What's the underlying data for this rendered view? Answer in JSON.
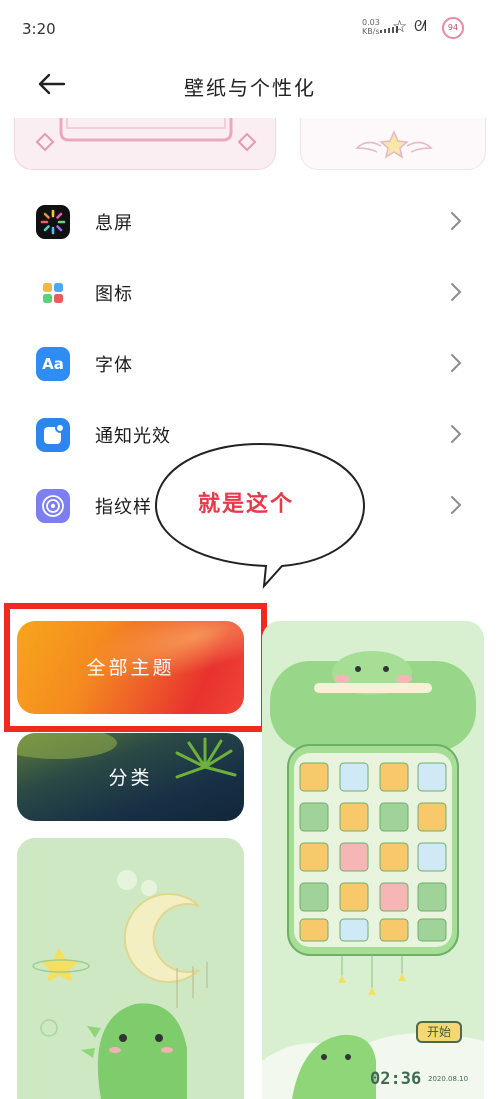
{
  "status_bar": {
    "time": "3:20",
    "net_speed_value": "0.03",
    "net_speed_unit": "KB/s",
    "battery": "94"
  },
  "header": {
    "title": "壁纸与个性化",
    "back_icon": "arrow-left-icon"
  },
  "menu": {
    "items": [
      {
        "label": "息屏",
        "icon": "always-on-display-icon"
      },
      {
        "label": "图标",
        "icon": "app-icons-grid-icon"
      },
      {
        "label": "字体",
        "icon": "font-icon",
        "icon_text": "Aa"
      },
      {
        "label": "通知光效",
        "icon": "notification-light-icon"
      },
      {
        "label": "指纹样",
        "icon": "fingerprint-icon"
      }
    ]
  },
  "annotation": {
    "text": "就是这个"
  },
  "themes": {
    "all_themes_label": "全部主题",
    "category_label": "分类",
    "preview": {
      "time": "02:36",
      "date": "2020.08.10",
      "start_button": "开始"
    }
  },
  "colors": {
    "highlight_box": "#ef2a1e",
    "annotation_text": "#e8384a",
    "accent_blue": "#2f8cf2"
  }
}
